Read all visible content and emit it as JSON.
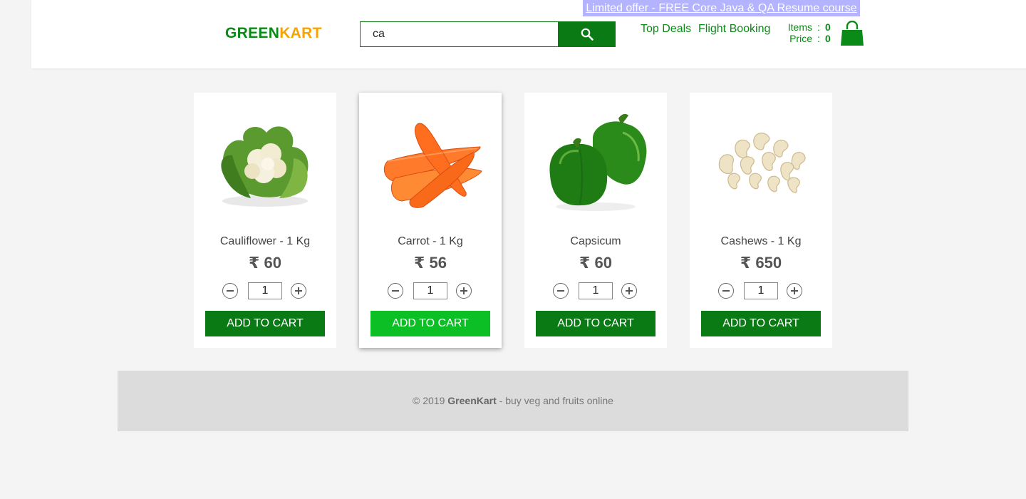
{
  "header": {
    "offer_text": "Limited offer - FREE Core Java & QA Resume course",
    "logo_part1": "GREEN",
    "logo_part2": "KART",
    "search_value": "ca",
    "nav": {
      "top_deals": "Top Deals",
      "flight_booking": "Flight Booking"
    },
    "cart": {
      "items_label": "Items",
      "items_value": "0",
      "price_label": "Price",
      "price_value": "0",
      "separator": ":"
    }
  },
  "colors": {
    "brand_green": "#0a7a15",
    "brand_orange": "#f7a400",
    "offer_bg": "#b3b3ff",
    "add_hover": "#0bbf25"
  },
  "products": [
    {
      "name": "Cauliflower - 1 Kg",
      "price": "₹ 60",
      "qty": "1",
      "button": "ADD TO CART",
      "icon": "cauliflower-image"
    },
    {
      "name": "Carrot - 1 Kg",
      "price": "₹ 56",
      "qty": "1",
      "button": "ADD TO CART",
      "icon": "carrot-image"
    },
    {
      "name": "Capsicum",
      "price": "₹ 60",
      "qty": "1",
      "button": "ADD TO CART",
      "icon": "capsicum-image"
    },
    {
      "name": "Cashews - 1 Kg",
      "price": "₹ 650",
      "qty": "1",
      "button": "ADD TO CART",
      "icon": "cashews-image"
    }
  ],
  "footer": {
    "prefix": "© 2019 ",
    "brand": "GreenKart",
    "suffix": " - buy veg and fruits online"
  }
}
